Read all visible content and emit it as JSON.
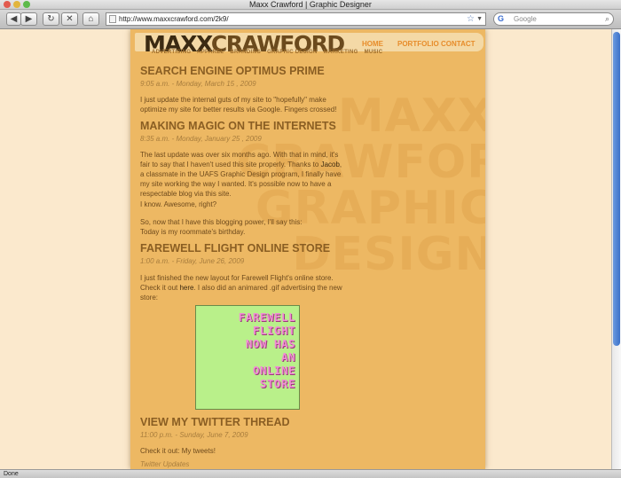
{
  "window": {
    "title": "Maxx Crawford | Graphic Designer"
  },
  "toolbar": {
    "back": "◀",
    "forward": "▶",
    "reload": "↻",
    "home": "⌂",
    "url": "http://www.maxxcrawford.com/2k9/",
    "search_placeholder": "Google"
  },
  "status": {
    "text": "Done"
  },
  "site": {
    "logo_part1": "MAXX",
    "logo_part2": "CRAWFORD",
    "nav": [
      "HOME",
      "PORTFOLIO",
      "CONTACT"
    ],
    "subnav": [
      "ADVERTISING",
      "APPAREL",
      "BRANDING",
      "GRAPHIC DESIGN",
      "MARKETING",
      "MUSIC"
    ],
    "background_words": [
      "MAXX",
      "CRAWFORD",
      "GRAPHIC",
      "DESIGN"
    ]
  },
  "posts": [
    {
      "title": "SEARCH ENGINE OPTIMUS PRIME",
      "date": "9:05 a.m. - Monday, March 15 , 2009",
      "body": "I just update the internal guts of my site to \"hopefully\" make optimize my site for better results via Google. Fingers crossed!"
    },
    {
      "title": "MAKING MAGIC ON THE INTERNETS",
      "date": "8:35 a.m. - Monday, January 25 , 2009",
      "body_before_link": "The last update was over six months ago. With that in mind, it's fair to say that I haven't used this site properly. Thanks to ",
      "link": "Jacob",
      "body_after_link": ", a classmate in the UAFS Graphic Design program, I finally have my site working the way I wanted. It's possible now to have a respectable blog via this site.",
      "body2": "I know. Awesome, right?",
      "body3a": "So, now that I have this blogging power, I'll say this:",
      "body3b": "Today is my roommate's birthday."
    },
    {
      "title": "FAREWELL FLIGHT ONLINE STORE",
      "date": "1:00 a.m. - Friday, June 26, 2009",
      "body_before_link": "I just finished the new layout for Farewell Flight's online store. Check it out ",
      "link": "here",
      "body_after_link": ". I also did an animared .gif advertising the new store:",
      "promo_lines": [
        "FAREWELL",
        "FLIGHT",
        "NOW HAS",
        "AN",
        "ONLINE",
        "STORE"
      ]
    },
    {
      "title": "VIEW MY TWITTER THREAD",
      "date": "11:00 p.m. - Sunday, June 7, 2009",
      "body": "Check it out: My tweets!",
      "footer": "Twitter Updates"
    }
  ],
  "colors": {
    "page_bg": "#fbe9cd",
    "content_bg": "#edb863",
    "accent": "#e78c2a",
    "promo_bg": "#b9f08a",
    "promo_text": "#f08ed4"
  }
}
